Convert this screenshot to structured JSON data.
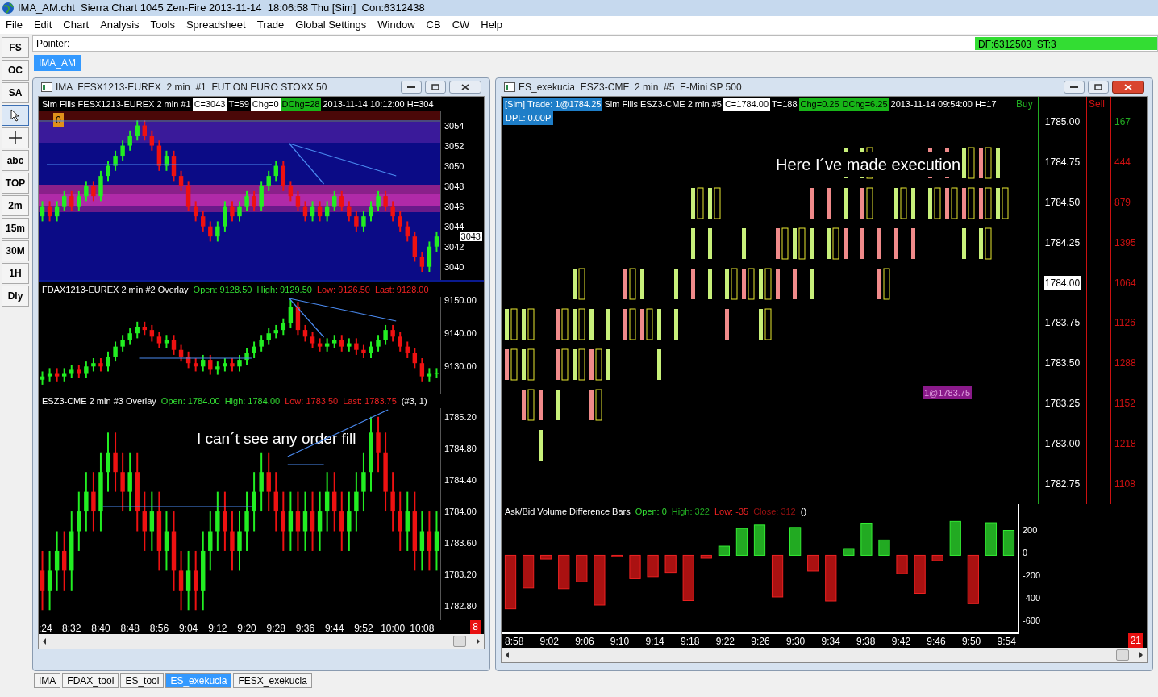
{
  "title_bar": {
    "title": "IMA_AM.cht  Sierra Chart 1045 Zen-Fire 2013-11-14  18:06:58 Thu [Sim]  Con:6312438"
  },
  "menu": [
    "File",
    "Edit",
    "Chart",
    "Analysis",
    "Tools",
    "Spreadsheet",
    "Trade",
    "Global Settings",
    "Window",
    "CB",
    "CW",
    "Help"
  ],
  "toolbar": [
    {
      "kind": "text",
      "label": "FS",
      "selected": false
    },
    {
      "kind": "text",
      "label": "OC",
      "selected": false
    },
    {
      "kind": "text",
      "label": "SA",
      "selected": false
    },
    {
      "kind": "pointer",
      "selected": true
    },
    {
      "kind": "crosshair",
      "selected": false
    },
    {
      "kind": "text",
      "label": "abc",
      "selected": false
    },
    {
      "kind": "text",
      "label": "TOP",
      "selected": false
    },
    {
      "kind": "text",
      "label": "2m",
      "selected": false
    },
    {
      "kind": "text",
      "label": "15m",
      "selected": false
    },
    {
      "kind": "text",
      "label": "30M",
      "selected": false
    },
    {
      "kind": "text",
      "label": "1H",
      "selected": false
    },
    {
      "kind": "text",
      "label": "Dly",
      "selected": false
    }
  ],
  "pointer_bar": {
    "label": "Pointer:",
    "status": "DF:6312503  ST:3"
  },
  "chartbook_tabs": [
    {
      "label": "IMA_AM",
      "selected": true
    }
  ],
  "left_window": {
    "title": "IMA  FESX1213-EUREX  2 min  #1  FUT ON EURO STOXX 50",
    "active": false,
    "header": [
      {
        "text": "Sim Fills  FESX1213-EUREX  2 min  #1",
        "kind": "text"
      },
      {
        "text": "C=3043",
        "kind": "value"
      },
      {
        "text": "T=59",
        "kind": "text"
      },
      {
        "text": "Chg=0",
        "kind": "value"
      },
      {
        "text": "DChg=28",
        "kind": "change"
      },
      {
        "text": "2013-11-14 10:12:00 H=304",
        "kind": "text"
      }
    ],
    "region_1": {
      "marker": "0",
      "current": "3043",
      "chart_data": {
        "type": "candlestick",
        "ylim": [
          3038.7,
          3055.4
        ],
        "yticks": [
          3054,
          3052,
          3050,
          3048,
          3046,
          3044,
          3042,
          3040
        ],
        "categories": [
          null,
          null,
          null,
          null,
          null,
          null,
          null,
          null,
          null,
          null,
          null,
          null,
          null,
          null,
          null,
          null,
          null,
          null,
          null,
          null,
          null,
          null,
          null,
          null,
          null,
          null,
          null,
          null,
          null,
          null,
          null,
          null,
          null,
          null,
          null,
          null,
          null,
          null,
          null,
          null,
          null,
          null,
          null,
          null,
          null,
          null,
          null,
          null,
          null,
          null,
          null,
          null,
          null,
          null,
          null
        ],
        "ohlc": [
          [
            3045,
            3046.5,
            3044.5,
            3046
          ],
          [
            3046,
            3046.5,
            3044.5,
            3045
          ],
          [
            3045,
            3046.5,
            3044.5,
            3046
          ],
          [
            3046,
            3047.5,
            3045.5,
            3047
          ],
          [
            3047,
            3047.5,
            3045.5,
            3046
          ],
          [
            3046,
            3047.5,
            3045.5,
            3047
          ],
          [
            3047,
            3048.5,
            3046.5,
            3048
          ],
          [
            3048,
            3048.5,
            3046.5,
            3047
          ],
          [
            3047,
            3049.5,
            3046.5,
            3049
          ],
          [
            3049,
            3050.5,
            3048.5,
            3050
          ],
          [
            3050,
            3051.5,
            3049.5,
            3051
          ],
          [
            3051,
            3052.5,
            3050.5,
            3052
          ],
          [
            3052,
            3053.5,
            3051.5,
            3053
          ],
          [
            3053,
            3054.5,
            3052.5,
            3054
          ],
          [
            3054,
            3054.5,
            3052.5,
            3053
          ],
          [
            3053,
            3053.5,
            3051.5,
            3052
          ],
          [
            3052,
            3052.5,
            3049.5,
            3050
          ],
          [
            3050,
            3051.5,
            3049.5,
            3051
          ],
          [
            3051,
            3051.5,
            3048.5,
            3049
          ],
          [
            3049,
            3049.5,
            3047.5,
            3048
          ],
          [
            3048,
            3048.5,
            3045.5,
            3046
          ],
          [
            3046,
            3046.5,
            3044.5,
            3045
          ],
          [
            3045,
            3045.5,
            3043.5,
            3044
          ],
          [
            3044,
            3044.5,
            3042.5,
            3043
          ],
          [
            3043,
            3044.5,
            3042.5,
            3044
          ],
          [
            3044,
            3046.5,
            3043.5,
            3046
          ],
          [
            3046,
            3046.5,
            3044.5,
            3045
          ],
          [
            3045,
            3046.5,
            3044.5,
            3046
          ],
          [
            3046,
            3047.5,
            3045.5,
            3047
          ],
          [
            3047,
            3047.5,
            3045.5,
            3046
          ],
          [
            3046,
            3048.5,
            3045.5,
            3048
          ],
          [
            3048,
            3049.5,
            3047.5,
            3049
          ],
          [
            3049,
            3050.5,
            3048.5,
            3050
          ],
          [
            3050,
            3050.5,
            3047.5,
            3048
          ],
          [
            3048,
            3048.5,
            3046.5,
            3047
          ],
          [
            3047,
            3047.5,
            3045.5,
            3046
          ],
          [
            3046,
            3046.5,
            3044.5,
            3045
          ],
          [
            3045,
            3046.5,
            3044.5,
            3046
          ],
          [
            3046,
            3046.5,
            3044.5,
            3045
          ],
          [
            3045,
            3046.5,
            3044.5,
            3046
          ],
          [
            3046,
            3047.5,
            3045.5,
            3047
          ],
          [
            3047,
            3047.5,
            3045.5,
            3046
          ],
          [
            3046,
            3046.5,
            3044.5,
            3045
          ],
          [
            3045,
            3045.5,
            3043.5,
            3044
          ],
          [
            3044,
            3045.5,
            3043.5,
            3045
          ],
          [
            3045,
            3046.5,
            3044.5,
            3046
          ],
          [
            3046,
            3047.5,
            3045.5,
            3047
          ],
          [
            3047,
            3047.5,
            3045.5,
            3046
          ],
          [
            3046,
            3046.5,
            3044.5,
            3045
          ],
          [
            3045,
            3045.5,
            3043.5,
            3044
          ],
          [
            3044,
            3044.5,
            3042.5,
            3043
          ],
          [
            3043,
            3043.5,
            3040.5,
            3041
          ],
          [
            3041,
            3041.5,
            3039.5,
            3040
          ],
          [
            3040,
            3042.5,
            3039.5,
            3042
          ],
          [
            3042,
            3043.5,
            3041.5,
            3043
          ]
        ]
      }
    },
    "region_2": {
      "title": "FDAX1213-EUREX  2 min  #2 Overlay",
      "stats": [
        {
          "text": "Open: 9128.50",
          "color": "#33dd33"
        },
        {
          "text": "High: 9129.50",
          "color": "#33dd33"
        },
        {
          "text": "Low: 9126.50",
          "color": "#ee2222"
        },
        {
          "text": "Last: 9128.00",
          "color": "#ee2222"
        }
      ],
      "chart_data": {
        "type": "candlestick",
        "ylim": [
          9121.8,
          9151
        ],
        "yticks": [
          {
            "value": 9150,
            "label": "9150.00"
          },
          {
            "value": 9140,
            "label": "9140.00"
          },
          {
            "value": 9130,
            "label": "9130.00"
          }
        ],
        "categories": [
          null,
          null,
          null,
          null,
          null,
          null,
          null,
          null,
          null,
          null,
          null,
          null,
          null,
          null,
          null,
          null,
          null,
          null,
          null,
          null,
          null,
          null,
          null,
          null,
          null,
          null,
          null,
          null,
          null,
          null,
          null,
          null,
          null,
          null,
          null,
          null,
          null,
          null,
          null,
          null,
          null,
          null,
          null,
          null,
          null,
          null,
          null,
          null,
          null,
          null,
          null,
          null,
          null,
          null,
          null
        ],
        "ohlc": [
          [
            9126,
            9128.5,
            9124.5,
            9127
          ],
          [
            9127,
            9129.5,
            9125.5,
            9128
          ],
          [
            9128,
            9129.5,
            9125.5,
            9127
          ],
          [
            9127,
            9129.5,
            9125.5,
            9128
          ],
          [
            9128,
            9130.5,
            9126.5,
            9129
          ],
          [
            9129,
            9130.5,
            9126.5,
            9128
          ],
          [
            9128,
            9131.5,
            9126.5,
            9130
          ],
          [
            9130,
            9132.5,
            9128.5,
            9131
          ],
          [
            9131,
            9132.5,
            9128.5,
            9130
          ],
          [
            9130,
            9134.5,
            9128.5,
            9133
          ],
          [
            9133,
            9137.5,
            9131.5,
            9136
          ],
          [
            9136,
            9139.5,
            9134.5,
            9138
          ],
          [
            9138,
            9141.5,
            9136.5,
            9140
          ],
          [
            9140,
            9143.5,
            9138.5,
            9142
          ],
          [
            9142,
            9143.5,
            9139.5,
            9141
          ],
          [
            9141,
            9142.5,
            9137.5,
            9139
          ],
          [
            9139,
            9140.5,
            9135.5,
            9137
          ],
          [
            9137,
            9139.5,
            9135.5,
            9138
          ],
          [
            9138,
            9139.5,
            9133.5,
            9135
          ],
          [
            9135,
            9136.5,
            9131.5,
            9133
          ],
          [
            9133,
            9134.5,
            9129.5,
            9131
          ],
          [
            9131,
            9132.5,
            9128.5,
            9130
          ],
          [
            9130,
            9133.5,
            9128.5,
            9132
          ],
          [
            9132,
            9133.5,
            9127.5,
            9129
          ],
          [
            9129,
            9131.5,
            9127.5,
            9130
          ],
          [
            9130,
            9132.5,
            9128.5,
            9131
          ],
          [
            9131,
            9132.5,
            9128.5,
            9130
          ],
          [
            9130,
            9133.5,
            9128.5,
            9132
          ],
          [
            9132,
            9135.5,
            9130.5,
            9134
          ],
          [
            9134,
            9137.5,
            9132.5,
            9136
          ],
          [
            9136,
            9139.5,
            9134.5,
            9138
          ],
          [
            9138,
            9141.5,
            9136.5,
            9140
          ],
          [
            9140,
            9142.5,
            9138.5,
            9141
          ],
          [
            9141,
            9144.5,
            9139.5,
            9143
          ],
          [
            9143,
            9150,
            9141.5,
            9148
          ],
          [
            9148,
            9149.5,
            9139.5,
            9141
          ],
          [
            9141,
            9142.5,
            9137.5,
            9139
          ],
          [
            9139,
            9140.5,
            9135.5,
            9137
          ],
          [
            9137,
            9138.5,
            9134.5,
            9136
          ],
          [
            9136,
            9138.5,
            9134.5,
            9137
          ],
          [
            9137,
            9139.5,
            9135.5,
            9138
          ],
          [
            9138,
            9139.5,
            9134.5,
            9136
          ],
          [
            9136,
            9138.5,
            9134.5,
            9137
          ],
          [
            9137,
            9138.5,
            9133.5,
            9135
          ],
          [
            9135,
            9136.5,
            9132.5,
            9134
          ],
          [
            9134,
            9137.5,
            9132.5,
            9136
          ],
          [
            9136,
            9139.5,
            9134.5,
            9138
          ],
          [
            9138,
            9142.5,
            9136.5,
            9141
          ],
          [
            9141,
            9142.5,
            9137.5,
            9139
          ],
          [
            9139,
            9140.5,
            9134.5,
            9136
          ],
          [
            9136,
            9137.5,
            9132.5,
            9134
          ],
          [
            9134,
            9135.5,
            9129.5,
            9131
          ],
          [
            9131,
            9132.5,
            9125.5,
            9127
          ],
          [
            9127,
            9129.5,
            9125.5,
            9128
          ],
          [
            9128,
            9129.5,
            9126.5,
            9128
          ]
        ]
      }
    },
    "region_3": {
      "title": "ESZ3-CME  2 min  #3 Overlay",
      "stats": [
        {
          "text": "Open: 1784.00",
          "color": "#33dd33"
        },
        {
          "text": "High: 1784.00",
          "color": "#33dd33"
        },
        {
          "text": "Low: 1783.50",
          "color": "#ee2222"
        },
        {
          "text": "Last: 1783.75",
          "color": "#ee2222"
        }
      ],
      "suffix": "(#3, 1)",
      "note": "I can´t see any order fill",
      "chart_data": {
        "type": "candlestick",
        "ylim": [
          1782.63,
          1785.31
        ],
        "yticks": [
          {
            "value": 1785.2,
            "label": "1785.20"
          },
          {
            "value": 1784.8,
            "label": "1784.80"
          },
          {
            "value": 1784.4,
            "label": "1784.40"
          },
          {
            "value": 1784.0,
            "label": "1784.00"
          },
          {
            "value": 1783.6,
            "label": "1783.60"
          },
          {
            "value": 1783.2,
            "label": "1783.20"
          },
          {
            "value": 1782.8,
            "label": "1782.80"
          }
        ],
        "categories": [
          ":24",
          null,
          null,
          null,
          "8:32",
          null,
          null,
          null,
          "8:40",
          null,
          null,
          null,
          "8:48",
          null,
          null,
          null,
          "8:56",
          null,
          null,
          null,
          "9:04",
          null,
          null,
          null,
          "9:12",
          null,
          null,
          null,
          "9:20",
          null,
          null,
          null,
          "9:28",
          null,
          null,
          null,
          "9:36",
          null,
          null,
          null,
          "9:44",
          null,
          null,
          null,
          "9:52",
          null,
          null,
          null,
          "10:00",
          null,
          null,
          null,
          "10:08",
          null,
          null
        ],
        "ohlc": [
          [
            1783.25,
            1783.5,
            1782.75,
            1783.0
          ],
          [
            1783.0,
            1783.5,
            1782.75,
            1783.25
          ],
          [
            1783.25,
            1783.75,
            1783.0,
            1783.5
          ],
          [
            1783.5,
            1783.75,
            1783.0,
            1783.25
          ],
          [
            1783.25,
            1784.0,
            1783.0,
            1783.75
          ],
          [
            1783.75,
            1784.25,
            1783.5,
            1784.0
          ],
          [
            1784.0,
            1784.5,
            1783.75,
            1784.25
          ],
          [
            1784.25,
            1784.5,
            1783.75,
            1784.0
          ],
          [
            1784.0,
            1784.75,
            1783.75,
            1784.5
          ],
          [
            1784.5,
            1785.0,
            1784.25,
            1784.75
          ],
          [
            1784.75,
            1785.0,
            1784.25,
            1784.5
          ],
          [
            1784.5,
            1784.75,
            1784.0,
            1784.25
          ],
          [
            1784.25,
            1784.75,
            1784.0,
            1784.5
          ],
          [
            1784.5,
            1784.75,
            1783.75,
            1784.0
          ],
          [
            1784.0,
            1784.25,
            1783.5,
            1783.75
          ],
          [
            1783.75,
            1784.25,
            1783.5,
            1784.0
          ],
          [
            1784.0,
            1784.25,
            1783.25,
            1783.5
          ],
          [
            1783.5,
            1784.0,
            1783.25,
            1783.75
          ],
          [
            1783.75,
            1784.0,
            1783.0,
            1783.25
          ],
          [
            1783.25,
            1783.5,
            1782.75,
            1783.0
          ],
          [
            1783.0,
            1783.5,
            1782.75,
            1783.25
          ],
          [
            1783.25,
            1783.5,
            1782.75,
            1783.0
          ],
          [
            1783.0,
            1783.75,
            1782.75,
            1783.5
          ],
          [
            1783.5,
            1784.0,
            1783.25,
            1783.75
          ],
          [
            1783.75,
            1784.25,
            1783.5,
            1784.0
          ],
          [
            1784.0,
            1784.25,
            1783.5,
            1783.75
          ],
          [
            1783.75,
            1784.0,
            1783.25,
            1783.5
          ],
          [
            1783.5,
            1784.0,
            1783.25,
            1783.75
          ],
          [
            1783.75,
            1784.25,
            1783.5,
            1784.0
          ],
          [
            1784.0,
            1784.5,
            1783.75,
            1784.25
          ],
          [
            1784.25,
            1784.75,
            1784.0,
            1784.5
          ],
          [
            1784.5,
            1784.75,
            1784.0,
            1784.25
          ],
          [
            1784.25,
            1784.5,
            1783.75,
            1784.0
          ],
          [
            1784.0,
            1784.25,
            1783.5,
            1783.75
          ],
          [
            1783.75,
            1784.25,
            1783.5,
            1784.0
          ],
          [
            1784.0,
            1784.25,
            1783.5,
            1783.75
          ],
          [
            1783.75,
            1784.25,
            1783.5,
            1784.0
          ],
          [
            1784.0,
            1784.25,
            1783.5,
            1783.75
          ],
          [
            1783.75,
            1784.25,
            1783.5,
            1784.0
          ],
          [
            1784.0,
            1784.5,
            1783.75,
            1784.25
          ],
          [
            1784.25,
            1784.5,
            1783.75,
            1784.0
          ],
          [
            1784.0,
            1784.25,
            1783.5,
            1783.75
          ],
          [
            1783.75,
            1784.25,
            1783.5,
            1784.0
          ],
          [
            1784.0,
            1784.5,
            1783.75,
            1784.25
          ],
          [
            1784.25,
            1784.75,
            1784.0,
            1784.5
          ],
          [
            1784.5,
            1785.2,
            1784.25,
            1785.0
          ],
          [
            1785.0,
            1785.2,
            1784.5,
            1784.75
          ],
          [
            1784.75,
            1785.0,
            1784.0,
            1784.25
          ],
          [
            1784.25,
            1784.5,
            1783.75,
            1784.0
          ],
          [
            1784.0,
            1784.25,
            1783.5,
            1783.75
          ],
          [
            1783.75,
            1784.25,
            1783.5,
            1784.0
          ],
          [
            1784.0,
            1784.25,
            1783.25,
            1783.5
          ],
          [
            1783.5,
            1784.0,
            1783.25,
            1783.75
          ],
          [
            1783.75,
            1784.0,
            1783.25,
            1783.5
          ],
          [
            1783.5,
            1784.0,
            1783.25,
            1783.75
          ]
        ]
      }
    },
    "badge": "8"
  },
  "right_window": {
    "title": "ES_exekucia  ESZ3-CME  2 min  #5  E-Mini SP 500",
    "active": true,
    "header": [
      {
        "text": "[Sim]  Trade: 1@1784.25",
        "kind": "trade"
      },
      {
        "text": "Sim Fills  ESZ3-CME  2 min  #5",
        "kind": "text"
      },
      {
        "text": "C=1784.00",
        "kind": "value"
      },
      {
        "text": "T=188",
        "kind": "text"
      },
      {
        "text": "Chg=0.25",
        "kind": "change"
      },
      {
        "text": "DChg=6.25",
        "kind": "change"
      },
      {
        "text": "2013-11-14 09:54:00 H=17",
        "kind": "text"
      }
    ],
    "dpl": "DPL: 0.00P",
    "buy_label": "Buy",
    "sell_label": "Sell",
    "ladder": [
      {
        "price": "1785.00",
        "volume": "167",
        "current": false,
        "color": "#22aa22"
      },
      {
        "price": "1784.75",
        "volume": "444",
        "current": false,
        "color": "#cc1111"
      },
      {
        "price": "1784.50",
        "volume": "879",
        "current": false,
        "color": "#cc1111"
      },
      {
        "price": "1784.25",
        "volume": "1395",
        "current": false,
        "color": "#cc1111"
      },
      {
        "price": "1784.00",
        "volume": "1064",
        "current": true,
        "color": "#cc1111"
      },
      {
        "price": "1783.75",
        "volume": "1126",
        "current": false,
        "color": "#cc1111"
      },
      {
        "price": "1783.50",
        "volume": "1288",
        "current": false,
        "color": "#cc1111"
      },
      {
        "price": "1783.25",
        "volume": "1152",
        "current": false,
        "color": "#cc1111"
      },
      {
        "price": "1783.00",
        "volume": "1218",
        "current": false,
        "color": "#cc1111"
      },
      {
        "price": "1782.75",
        "volume": "1108",
        "current": false,
        "color": "#cc1111"
      }
    ],
    "note": "Here I´ve made execution",
    "order_label": "1@1783.75",
    "study": {
      "title": "Ask/Bid Volume Difference Bars",
      "stats": [
        {
          "text": "Open: 0",
          "color": "#33dd33"
        },
        {
          "text": "High: 322",
          "color": "#22aa22"
        },
        {
          "text": "Low: -35",
          "color": "#ee2222"
        },
        {
          "text": "Close: 312",
          "color": "#991111"
        }
      ],
      "suffix": "()",
      "axis": [
        "200",
        "0",
        "-200",
        "-400",
        "-600"
      ]
    },
    "time_axis": [
      "8:58",
      "9:02",
      "9:06",
      "9:10",
      "9:14",
      "9:18",
      "9:22",
      "9:26",
      "9:30",
      "9:34",
      "9:38",
      "9:42",
      "9:46",
      "9:50",
      "9:54"
    ],
    "badge": "21"
  },
  "bottom_tabs": [
    {
      "label": "IMA",
      "selected": false
    },
    {
      "label": "FDAX_tool",
      "selected": false
    },
    {
      "label": "ES_tool",
      "selected": false
    },
    {
      "label": "ES_exekucia",
      "selected": true
    },
    {
      "label": "FESX_exekucia",
      "selected": false
    }
  ]
}
